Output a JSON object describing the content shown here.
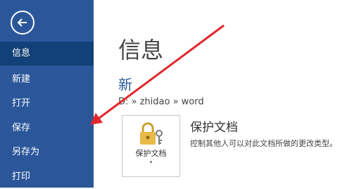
{
  "sidebar": {
    "items": [
      {
        "label": "信息",
        "active": true
      },
      {
        "label": "新建",
        "active": false
      },
      {
        "label": "打开",
        "active": false
      },
      {
        "label": "保存",
        "active": false
      },
      {
        "label": "另存为",
        "active": false
      },
      {
        "label": "打印",
        "active": false
      }
    ]
  },
  "main": {
    "title": "信息",
    "doc_name": "新",
    "doc_path": "D: » zhidao » word",
    "protect": {
      "button_label": "保护文档",
      "caret": "▾",
      "title": "保护文档",
      "description": "控制其他人可以对此文档所做的更改类型。"
    }
  },
  "icons": {
    "back": "back-arrow-icon",
    "lock": "lock-key-icon",
    "annotation": "red-arrow"
  },
  "colors": {
    "sidebar_bg": "#2b579a",
    "sidebar_active": "#124078",
    "accent_text": "#2b579a",
    "annotation": "#e0282d",
    "lock_gold": "#e9b949"
  }
}
